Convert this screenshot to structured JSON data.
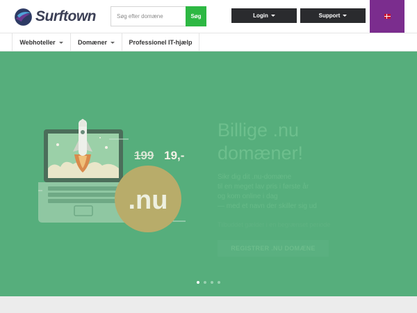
{
  "brand": {
    "name": "Surftown"
  },
  "search": {
    "placeholder": "Søg efter domæne",
    "button_label": "Søg"
  },
  "header": {
    "login_label": "Login",
    "support_label": "Support"
  },
  "nav": {
    "items": [
      {
        "label": "Webhoteller"
      },
      {
        "label": "Domæner"
      },
      {
        "label": "Professionel IT-hjælp"
      }
    ]
  },
  "hero": {
    "price_old": "199",
    "price_new": "19,-",
    "badge_text": ".nu",
    "title_line1": "Billige .nu",
    "title_line2": "domæner!",
    "body_lines": [
      "Sikr dig dit .nu-domæne",
      "til en meget lav pris i første år",
      "og kom online i dag",
      "— med et navn der skiller sig ud"
    ],
    "sub": "Tilbuddet gælder i en begrænset periode",
    "cta_label": "REGISTRER .NU DOMÆNE"
  },
  "carousel": {
    "slides": 4,
    "active": 1
  },
  "colors": {
    "accent_green": "#2db843",
    "hero_bg": "#56ae7c",
    "lang_purple": "#7b2d8e",
    "dark_button": "#2a2b2e",
    "badge_gold": "#b8ac6a"
  }
}
